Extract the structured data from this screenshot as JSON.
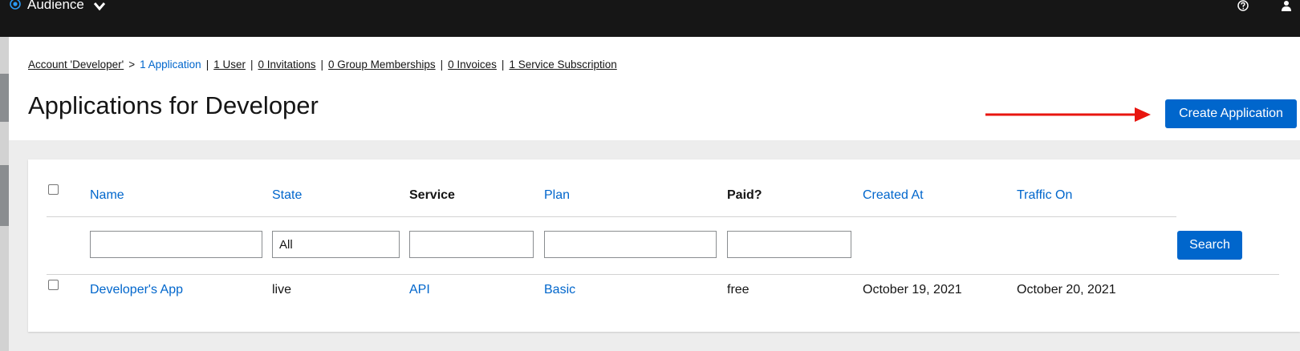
{
  "topbar": {
    "context": "Audience"
  },
  "breadcrumb": {
    "account": "Account 'Developer'",
    "separator": ">",
    "divider": "|",
    "items": [
      "1 Application",
      "1 User",
      "0 Invitations",
      "0 Group Memberships",
      "0 Invoices",
      "1 Service Subscription"
    ]
  },
  "page_title": "Applications for Developer",
  "create_button": "Create Application",
  "table": {
    "columns": [
      "Name",
      "State",
      "Service",
      "Plan",
      "Paid?",
      "Created At",
      "Traffic On"
    ],
    "filters": {
      "name": "",
      "state": "All",
      "service": "",
      "plan": "",
      "paid": ""
    },
    "search_button": "Search",
    "rows": [
      {
        "name": "Developer's App",
        "state": "live",
        "service": "API",
        "plan": "Basic",
        "paid": "free",
        "created_at": "October 19, 2021",
        "traffic_on": "October 20, 2021"
      }
    ]
  },
  "colors": {
    "accent": "#0066cc",
    "topbar": "#161616",
    "arrow": "#e8150f"
  }
}
